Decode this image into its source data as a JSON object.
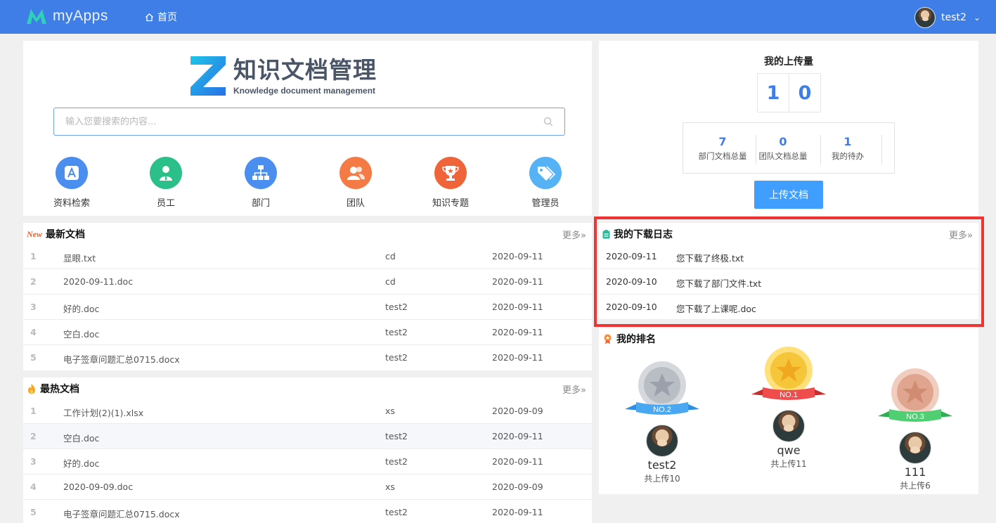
{
  "header": {
    "app_name": "myApps",
    "home_label": "首页",
    "username": "test2"
  },
  "brand": {
    "title": "知识文档管理",
    "subtitle": "Knowledge document management"
  },
  "search": {
    "placeholder": "输入您要搜索的内容...",
    "value": ""
  },
  "quick_entries": [
    {
      "label": "资料检索",
      "icon": "document-a-icon",
      "color": "#4a8ef0"
    },
    {
      "label": "员工",
      "icon": "person-icon",
      "color": "#2bbf8a"
    },
    {
      "label": "部门",
      "icon": "org-chart-icon",
      "color": "#4a8ef0"
    },
    {
      "label": "团队",
      "icon": "team-icon",
      "color": "#f47b46"
    },
    {
      "label": "知识专题",
      "icon": "trophy-icon",
      "color": "#f0643a"
    },
    {
      "label": "管理员",
      "icon": "tag-icon",
      "color": "#55b3f5"
    }
  ],
  "latest_docs": {
    "badge": "New",
    "title": "最新文档",
    "more": "更多",
    "rows": [
      {
        "index": "1",
        "name": "显眼.txt",
        "user": "cd",
        "date": "2020-09-11"
      },
      {
        "index": "2",
        "name": "2020-09-11.doc",
        "user": "cd",
        "date": "2020-09-11"
      },
      {
        "index": "3",
        "name": "好的.doc",
        "user": "test2",
        "date": "2020-09-11"
      },
      {
        "index": "4",
        "name": "空白.doc",
        "user": "test2",
        "date": "2020-09-11"
      },
      {
        "index": "5",
        "name": "电子签章问题汇总0715.docx",
        "user": "test2",
        "date": "2020-09-11"
      }
    ]
  },
  "hottest_docs": {
    "title": "最热文档",
    "more": "更多",
    "rows": [
      {
        "index": "1",
        "name": "工作计划(2)(1).xlsx",
        "user": "xs",
        "date": "2020-09-09"
      },
      {
        "index": "2",
        "name": "空白.doc",
        "user": "test2",
        "date": "2020-09-11"
      },
      {
        "index": "3",
        "name": "好的.doc",
        "user": "test2",
        "date": "2020-09-11"
      },
      {
        "index": "4",
        "name": "2020-09-09.doc",
        "user": "xs",
        "date": "2020-09-09"
      },
      {
        "index": "5",
        "name": "电子签章问题汇总0715.docx",
        "user": "test2",
        "date": "2020-09-11"
      }
    ]
  },
  "upload": {
    "title": "我的上传量",
    "digits": [
      "1",
      "0"
    ],
    "stats": [
      {
        "value": "7",
        "label": "部门文档总量"
      },
      {
        "value": "0",
        "label": "团队文档总量"
      },
      {
        "value": "1",
        "label": "我的待办"
      }
    ],
    "button": "上传文档"
  },
  "download_log": {
    "title": "我的下载日志",
    "more": "更多",
    "rows": [
      {
        "date": "2020-09-11",
        "text": "您下载了终极.txt"
      },
      {
        "date": "2020-09-10",
        "text": "您下载了部门文件.txt"
      },
      {
        "date": "2020-09-10",
        "text": "您下载了上课呢.doc"
      }
    ]
  },
  "ranking": {
    "title": "我的排名",
    "entries": [
      {
        "rank_label": "NO.2",
        "name": "test2",
        "count_text": "共上传10",
        "medal_color": "#b9bec5",
        "ribbon_color": "#4aa8f2"
      },
      {
        "rank_label": "NO.1",
        "name": "qwe",
        "count_text": "共上传11",
        "medal_color": "#f5c53a",
        "ribbon_color": "#ef4d4d"
      },
      {
        "rank_label": "NO.3",
        "name": "111",
        "count_text": "共上传6",
        "medal_color": "#e0a58f",
        "ribbon_color": "#4fce72"
      }
    ]
  },
  "colors": {
    "header_bg": "#3f7ee6",
    "accent": "#3f7ee6",
    "button": "#409eff",
    "highlight_frame": "#ef3434"
  }
}
